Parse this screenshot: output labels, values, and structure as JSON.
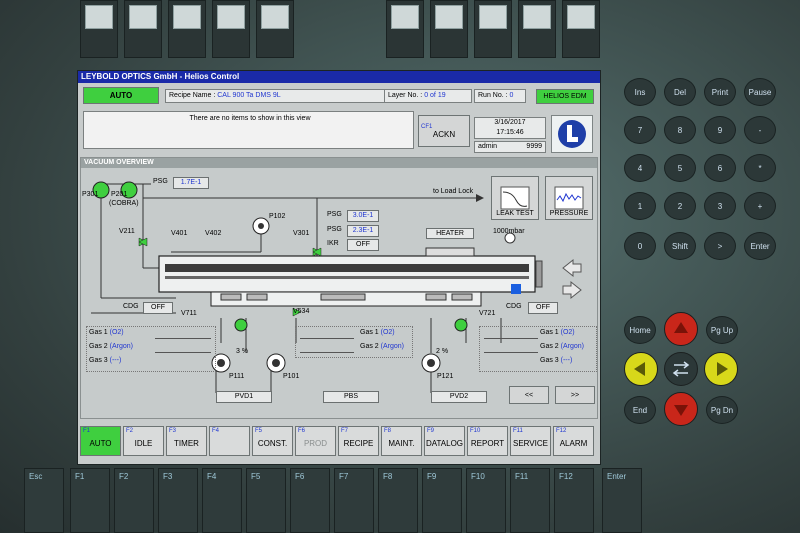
{
  "window": {
    "title": "LEYBOLD OPTICS GmbH - Helios Control"
  },
  "header": {
    "mode": "AUTO",
    "recipe_label": "Recipe Name :",
    "recipe_value": "CAL 900 Ta DMS 9L",
    "layer_label": "Layer No. :",
    "layer_value": "0  of 19",
    "run_label": "Run No. :",
    "run_value": "0",
    "system_label": "HELIOS EDM",
    "message": "There are no items to show in this view",
    "ack_key": "CF1",
    "ack_label": "ACKN",
    "date": "3/16/2017",
    "time": "17:15:46",
    "user": "admin",
    "user_level": "9999"
  },
  "vacuum": {
    "section_title": "VACUUM OVERVIEW",
    "psg_top_label": "PSG",
    "psg_top_value": "1.7E-1",
    "pumps": [
      "P301",
      "P201",
      "(COBRA)"
    ],
    "valves": {
      "v211": "V211",
      "v401": "V401",
      "v402": "V402",
      "p102": "P102",
      "v301": "V301",
      "v711": "V711",
      "v534": "V534",
      "v721": "V721"
    },
    "chamber_gauges": [
      {
        "label": "PSG",
        "value": "3.0E-1"
      },
      {
        "label": "PSG",
        "value": "2.3E-1"
      },
      {
        "label": "IKR",
        "value": "OFF"
      }
    ],
    "to_load_lock": "to Load Lock",
    "heater": "HEATER",
    "pressure_reading": "1000mbar",
    "leak_test": "LEAK TEST",
    "pressure_btn": "PRESSURE",
    "cdg_left_label": "CDG",
    "cdg_left_value": "OFF",
    "cdg_right_label": "CDG",
    "cdg_right_value": "OFF",
    "gas_left": [
      {
        "name": "Gas 1",
        "value": "(O2)"
      },
      {
        "name": "Gas 2",
        "value": "(Argon)"
      },
      {
        "name": "Gas 3",
        "value": "(---)"
      }
    ],
    "gas_mid": [
      {
        "name": "Gas 1",
        "value": "(O2)"
      },
      {
        "name": "Gas 2",
        "value": "(Argon)"
      }
    ],
    "gas_right": [
      {
        "name": "Gas 1",
        "value": "(O2)"
      },
      {
        "name": "Gas 2",
        "value": "(Argon)"
      },
      {
        "name": "Gas 3",
        "value": "(---)"
      }
    ],
    "pump_percent_left": "3 %",
    "pump_percent_right": "2 %",
    "lower_pumps": [
      "P111",
      "P101",
      "P121"
    ],
    "sources": [
      "PVD1",
      "PBS",
      "PVD2"
    ],
    "prev": "<<",
    "next": ">>"
  },
  "fkeys": [
    {
      "n": "F1",
      "t": "AUTO"
    },
    {
      "n": "F2",
      "t": "IDLE"
    },
    {
      "n": "F3",
      "t": "TIMER"
    },
    {
      "n": "F4",
      "t": ""
    },
    {
      "n": "F5",
      "t": "CONST."
    },
    {
      "n": "F6",
      "t": "PROD"
    },
    {
      "n": "F7",
      "t": "RECIPE"
    },
    {
      "n": "F8",
      "t": "MAINT."
    },
    {
      "n": "F9",
      "t": "DATALOG"
    },
    {
      "n": "F10",
      "t": "REPORT"
    },
    {
      "n": "F11",
      "t": "SERVICE"
    },
    {
      "n": "F12",
      "t": "ALARM"
    }
  ],
  "keypad": {
    "row1": [
      "Ins",
      "Del",
      "Print",
      "Pause"
    ],
    "row2": [
      "7",
      "8",
      "9",
      "-"
    ],
    "row3": [
      "4",
      "5",
      "6",
      "*"
    ],
    "row4": [
      "1",
      "2",
      "3",
      "+"
    ],
    "row5": [
      "0",
      "Shift",
      ">",
      "Enter"
    ],
    "nav": [
      "Home",
      "Pg Up",
      "End",
      "Pg Dn"
    ]
  },
  "bottom_keys": [
    "Esc",
    "F1",
    "F2",
    "F3",
    "F4",
    "F5",
    "F6",
    "F7",
    "F8",
    "F9",
    "F10",
    "F11",
    "F12",
    "Enter"
  ],
  "colors": {
    "accent_green": "#3fcf3f",
    "value_blue": "#2036d0",
    "title_blue": "#1a2aa8",
    "arrow_red": "#cc2a1a",
    "arrow_yellow": "#d8d81a"
  }
}
